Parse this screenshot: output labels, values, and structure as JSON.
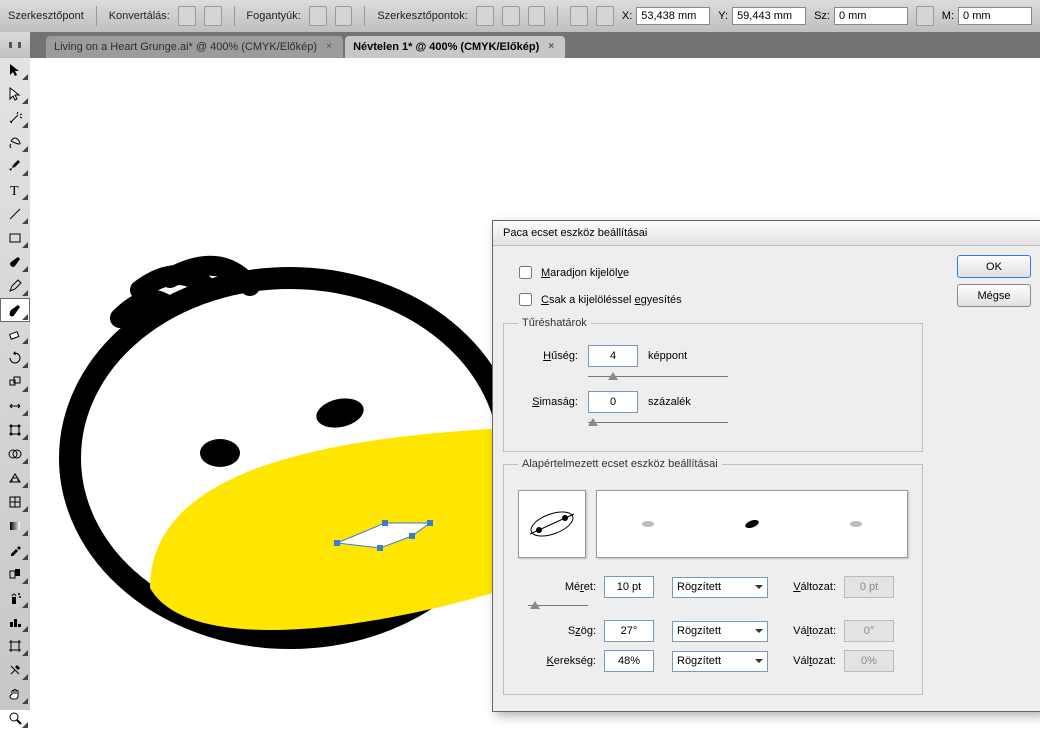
{
  "topbar": {
    "anchor_label": "Szerkesztőpont",
    "convert_label": "Konvertálás:",
    "handles_label": "Fogantyúk:",
    "anchors_label": "Szerkesztőpontok:",
    "x_prefix": "X:",
    "y_prefix": "Y:",
    "w_prefix": "Sz:",
    "h_prefix": "M:",
    "x_value": "53,438 mm",
    "y_value": "59,443 mm",
    "w_value": "0 mm",
    "h_value": "0 mm"
  },
  "tabs": {
    "inactive": "Living on a Heart Grunge.ai* @ 400% (CMYK/Előkép)",
    "active": "Névtelen 1* @ 400% (CMYK/Előkép)"
  },
  "tools": [
    "selection",
    "direct-selection",
    "magic-wand",
    "lasso",
    "pen",
    "type",
    "line",
    "rectangle",
    "paintbrush",
    "pencil",
    "blob-brush",
    "eraser",
    "rotate",
    "scale",
    "width",
    "free-transform",
    "shape-builder",
    "perspective",
    "mesh",
    "gradient",
    "eyedropper",
    "blend",
    "symbol-sprayer",
    "column-graph",
    "artboard",
    "slice",
    "hand",
    "zoom"
  ],
  "tool_selected": "blob-brush",
  "dialog": {
    "title": "Paca ecset eszköz beállításai",
    "keep_selected_html": "<span class='u'>M</span>aradjon kijelöl<span class='u'>v</span>e",
    "merge_only_html": "<span class='u'>C</span>sak a kijelöléssel <span class='u'>e</span>gyesítés",
    "tolerance_legend": "Tűréshatárok",
    "fidelity_label_html": "<span class='u'>H</span>űség:",
    "fidelity_value": "4",
    "fidelity_unit": "képpont",
    "smoothness_label_html": "<span class='u'>S</span>imaság:",
    "smoothness_value": "0",
    "smoothness_unit": "százalék",
    "defaults_legend": "Alapértelmezett ecset eszköz beállításai",
    "params": {
      "size": {
        "label_html": "Mé<span class='u'>r</span>et:",
        "value": "10 pt",
        "mode": "Rögzített",
        "var_label_html": "<span class='u'>V</span>áltozat:",
        "var_value": "0 pt"
      },
      "angle": {
        "label_html": "S<span class='u'>z</span>ög:",
        "value": "27°",
        "mode": "Rögzített",
        "var_label_html": "Vá<span class='u'>l</span>tozat:",
        "var_value": "0°"
      },
      "roundness": {
        "label_html": "<span class='u'>K</span>erekség:",
        "value": "48%",
        "mode": "Rögzített",
        "var_label_html": "Vál<span class='u'>t</span>ozat:",
        "var_value": "0%"
      }
    },
    "ok": "OK",
    "cancel": "Mégse"
  }
}
